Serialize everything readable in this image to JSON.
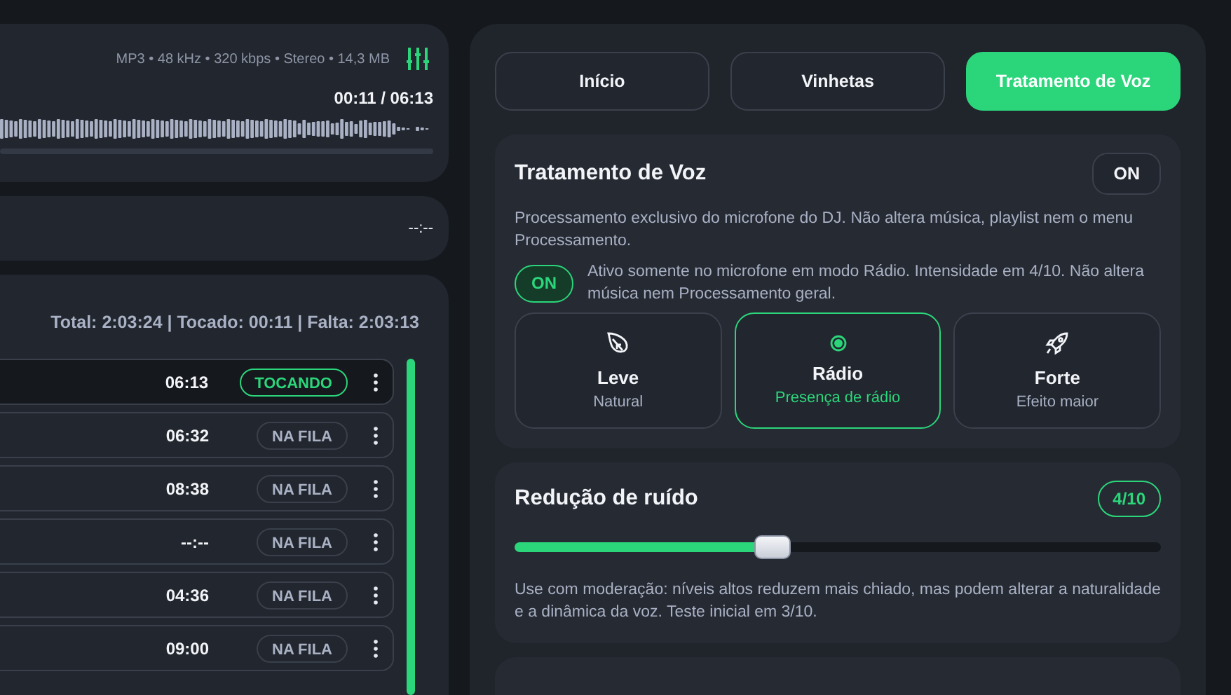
{
  "player": {
    "file_info": "MP3 • 48 kHz • 320 kbps • Stereo • 14,3 MB",
    "time": "00:11 / 06:13"
  },
  "next_card": {
    "time": "--:--"
  },
  "queue": {
    "summary": "Total: 2:03:24 | Tocado: 00:11 | Falta: 2:03:13",
    "rows": [
      {
        "duration": "06:13",
        "status": "TOCANDO",
        "kind": "playing"
      },
      {
        "duration": "06:32",
        "status": "NA FILA",
        "kind": "queued"
      },
      {
        "duration": "08:38",
        "status": "NA FILA",
        "kind": "queued"
      },
      {
        "duration": "--:--",
        "status": "NA FILA",
        "kind": "queued"
      },
      {
        "duration": "04:36",
        "status": "NA FILA",
        "kind": "queued"
      },
      {
        "duration": "09:00",
        "status": "NA FILA",
        "kind": "queued"
      }
    ]
  },
  "tabs": [
    {
      "label": "Início",
      "selected": false
    },
    {
      "label": "Vinhetas",
      "selected": false
    },
    {
      "label": "Tratamento de Voz",
      "selected": true
    }
  ],
  "voice": {
    "title": "Tratamento de Voz",
    "toggle": "ON",
    "description": "Processamento exclusivo do microfone do DJ. Não altera música, playlist nem o menu Processamento.",
    "status": {
      "label": "ON",
      "on": true,
      "note": "Ativo somente no microfone em modo Rádio. Intensidade em 4/10. Não altera música nem Processamento geral."
    },
    "presets": [
      {
        "name": "Leve",
        "subtitle": "Natural",
        "selected": false
      },
      {
        "name": "Rádio",
        "subtitle": "Presença de rádio",
        "selected": true
      },
      {
        "name": "Forte",
        "subtitle": "Efeito maior",
        "selected": false
      }
    ]
  },
  "noise": {
    "title": "Redução de ruído",
    "value": "4/10",
    "level": 0.4,
    "note": "Use com moderação: níveis altos reduzem mais chiado, mas podem alterar a naturalidade e a dinâmica da voz. Teste inicial em 3/10."
  }
}
